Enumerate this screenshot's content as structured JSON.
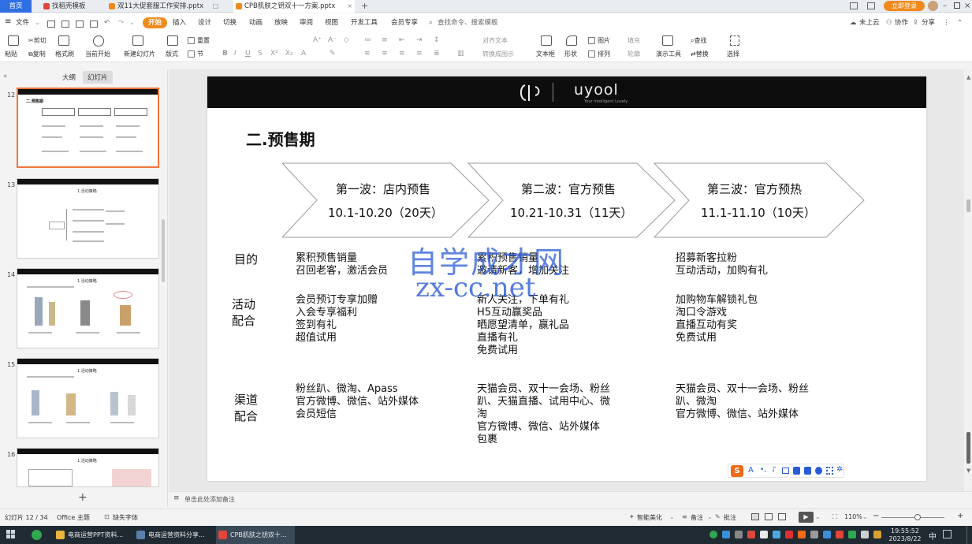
{
  "tabs": [
    {
      "label": "首页",
      "type": "home"
    },
    {
      "label": "找稻壳模板",
      "type": "doc",
      "color": "#e0463a"
    },
    {
      "label": "双11大促套服工作安排.pptx",
      "type": "doc",
      "color": "#f08a1c"
    },
    {
      "label": "CPB肌肤之钥双十一方案.pptx",
      "type": "doc",
      "color": "#f08a1c",
      "active": true
    }
  ],
  "new_tab": "+",
  "window_right": {
    "login": "立即登录"
  },
  "menubar": {
    "file": "文件",
    "items": [
      "开始",
      "插入",
      "设计",
      "切换",
      "动画",
      "放映",
      "审阅",
      "视图",
      "开发工具",
      "会员专享"
    ],
    "search": "查找命令、搜索模板",
    "right": [
      "未上云",
      "协作",
      "分享"
    ]
  },
  "ribbon": {
    "paste": "粘贴",
    "cut": "剪切",
    "copy": "复制",
    "format_painter": "格式刷",
    "from_current": "当前开始",
    "new_slide": "新建幻灯片",
    "layout": "版式",
    "section": "节",
    "reset": "重置",
    "text_box": "文本框",
    "shape": "形状",
    "arrange": "排列",
    "picture": "图片",
    "fill": "填充",
    "outline": "轮廓",
    "presenter": "演示工具",
    "find": "查找",
    "replace": "替换",
    "select": "选择",
    "convert_to_diagram": "转换成图示",
    "text_direction": "对齐文本"
  },
  "left_panel": {
    "tab_outline": "大纲",
    "tab_slides": "幻灯片",
    "collapse": "«",
    "add": "+",
    "slides": [
      {
        "num": "12",
        "title": "二.预售期"
      },
      {
        "num": "13",
        "title": "1.活动策略"
      },
      {
        "num": "14",
        "title": "1.活动策略"
      },
      {
        "num": "15",
        "title": "1.活动策略"
      },
      {
        "num": "16",
        "title": "1.活动策略"
      }
    ]
  },
  "slide": {
    "logo_text": "uyool",
    "logo_sub": "Your Intelligent Lovely",
    "heading": "二.预售期",
    "waves": [
      {
        "title": "第一波：店内预售",
        "dates": "10.1-10.20（20天）"
      },
      {
        "title": "第二波：官方预售",
        "dates": "10.21-10.31（11天）"
      },
      {
        "title": "第三波：官方预热",
        "dates": "11.1-11.10（10天）"
      }
    ],
    "rows": [
      {
        "label": [
          "目的"
        ],
        "cells": [
          [
            "累积预售销量",
            "召回老客，激活会员"
          ],
          [
            "累积预售销量",
            "邀请新客，增加关注"
          ],
          [
            "招募新客拉粉",
            "互动活动，加购有礼"
          ]
        ]
      },
      {
        "label": [
          "活动",
          "配合"
        ],
        "cells": [
          [
            "会员预订专享加赠",
            "入会专享福利",
            "签到有礼",
            "超值试用"
          ],
          [
            "新人关注，下单有礼",
            "H5互动赢奖品",
            "晒愿望清单，赢礼品",
            "直播有礼",
            "免费试用"
          ],
          [
            "加购物车解锁礼包",
            "淘口令游戏",
            "直播互动有奖",
            "免费试用"
          ]
        ]
      },
      {
        "label": [
          "渠道",
          "配合"
        ],
        "cells": [
          [
            "粉丝趴、微淘、Apass",
            "官方微博、微信、站外媒体",
            "会员短信"
          ],
          [
            "天猫会员、双十一会场、粉丝",
            "趴、天猫直播、试用中心、微",
            "淘",
            "官方微博、微信、站外媒体",
            "包裹"
          ],
          [
            "天猫会员、双十一会场、粉丝",
            "趴、微淘",
            "官方微博、微信、站外媒体"
          ]
        ]
      }
    ],
    "watermark_cn": "自学成才网",
    "watermark_url": "zx-cc.net",
    "ime_label": "A"
  },
  "notes_placeholder": "单击此处添加备注",
  "statusbar": {
    "slide_counter": "幻灯片 12 / 34",
    "theme": "Office 主题",
    "missing_font": "缺失字体",
    "smart_beautify": "智能美化",
    "notes": "备注",
    "comments": "批注",
    "zoom": "110%"
  },
  "taskbar": {
    "items": [
      {
        "label": "电商运营PPT资料...",
        "color": "#e8b43a"
      },
      {
        "label": "电商运营资料分享...",
        "color": "#5a7fa8"
      },
      {
        "label": "CPB肌肤之钥双十...",
        "color": "#e0463a",
        "active": true
      }
    ],
    "time": "19:55:52",
    "date": "2023/8/22"
  },
  "colors": {
    "accent_orange": "#f08a1c",
    "home_tab_blue": "#2f6fe4",
    "watermark_blue": "#2a5bd7",
    "selection_border": "#f2763a",
    "slide_header": "#0d0d0d"
  }
}
